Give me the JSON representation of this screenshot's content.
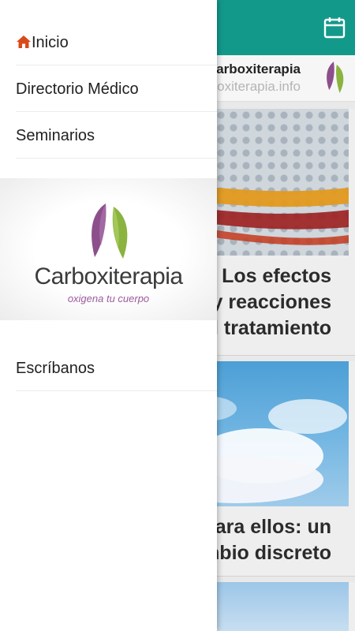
{
  "background": {
    "site": {
      "title": "Carboxiterapia",
      "url": "carboxiterapia.info"
    },
    "articles": [
      {
        "title_lines": [
          "Los efectos",
          "y reacciones",
          "del tratamiento"
        ]
      },
      {
        "title_lines": [
          "Para ellos: un",
          "cambio discreto"
        ]
      }
    ]
  },
  "drawer": {
    "items": [
      {
        "label": "Inicio",
        "icon": "home-icon"
      },
      {
        "label": "Directorio Médico"
      },
      {
        "label": "Seminarios"
      },
      {
        "label": "Escríbanos"
      }
    ],
    "brand": {
      "name": "Carboxiterapia",
      "tagline": "oxigena tu cuerpo"
    }
  },
  "colors": {
    "appbar": "#13998a",
    "home_icon": "#d84a1b",
    "brand_green": "#8ab33f",
    "brand_purple": "#8c4f8c"
  }
}
